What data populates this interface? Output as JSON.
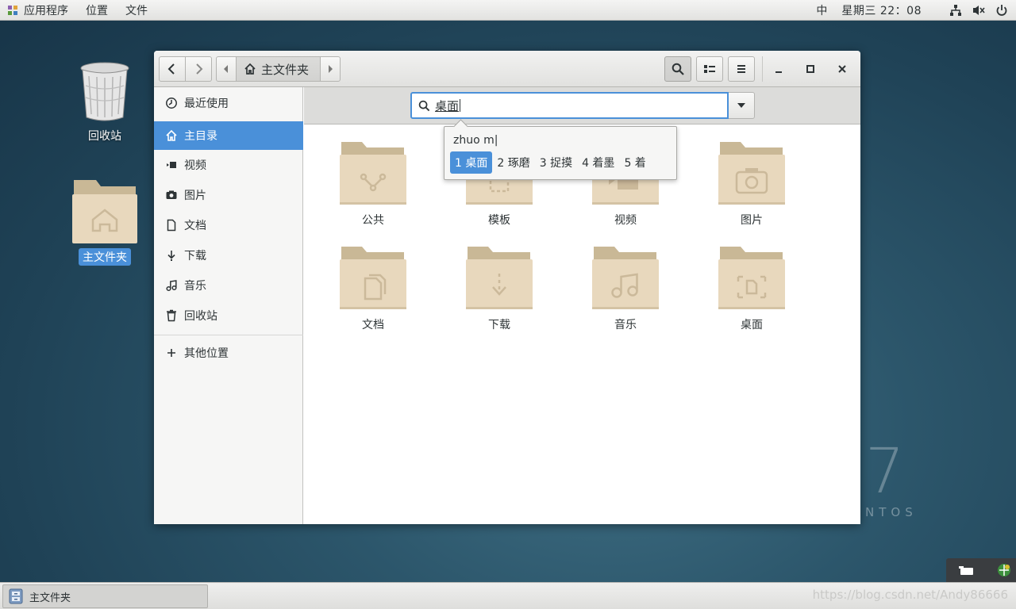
{
  "topbar": {
    "applications": "应用程序",
    "places": "位置",
    "file": "文件",
    "ime_indicator": "中",
    "clock": "星期三 22：08"
  },
  "desktop": {
    "trash_label": "回收站",
    "home_label": "主文件夹",
    "centos_number": "7",
    "centos_text": "NTOS"
  },
  "window": {
    "path_label": "主文件夹",
    "sidebar": {
      "items": [
        {
          "label": "最近使用",
          "icon": "clock-icon"
        },
        {
          "label": "主目录",
          "icon": "home-icon"
        },
        {
          "label": "视频",
          "icon": "video-icon"
        },
        {
          "label": "图片",
          "icon": "camera-icon"
        },
        {
          "label": "文档",
          "icon": "document-icon"
        },
        {
          "label": "下载",
          "icon": "download-icon"
        },
        {
          "label": "音乐",
          "icon": "music-icon"
        },
        {
          "label": "回收站",
          "icon": "trash-icon"
        }
      ],
      "other_locations": "其他位置"
    },
    "search": {
      "value": "桌面"
    },
    "ime_popup": {
      "preedit": "zhuo m|",
      "candidates": [
        "1 桌面",
        "2 琢磨",
        "3 捉摸",
        "4 着墨",
        "5 着"
      ]
    },
    "folders": [
      {
        "name": "公共",
        "icon": "share-icon"
      },
      {
        "name": "模板",
        "icon": "template-icon"
      },
      {
        "name": "视频",
        "icon": "video-icon"
      },
      {
        "name": "图片",
        "icon": "camera-icon"
      },
      {
        "name": "文档",
        "icon": "document-icon"
      },
      {
        "name": "下载",
        "icon": "download-icon"
      },
      {
        "name": "音乐",
        "icon": "music-icon"
      },
      {
        "name": "桌面",
        "icon": "desktop-icon"
      }
    ]
  },
  "taskbar": {
    "task_label": "主文件夹",
    "watermark": "https://blog.csdn.net/Andy86666"
  },
  "colors": {
    "accent": "#4a90d9",
    "folder": "#e8d8bd",
    "folder_tab": "#c9b896"
  }
}
